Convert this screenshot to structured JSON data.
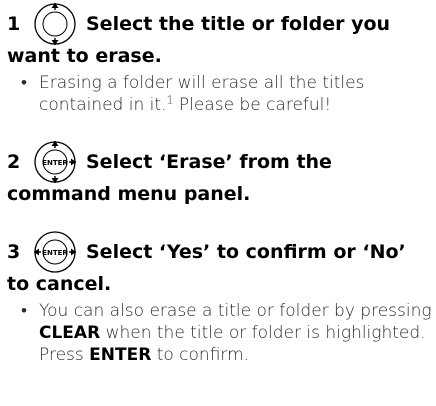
{
  "steps": [
    {
      "number": "1",
      "icon": "dpad-up-down-icon",
      "title_part1": "Select the title or folder you",
      "title_part2": "want to erase.",
      "note": {
        "text_before": "Erasing a folder will erase all the titles contained in it.",
        "footnote": "1",
        "text_after": " Please be careful!"
      }
    },
    {
      "number": "2",
      "icon": "enter-dpad-icon",
      "title_part1": "Select ‘Erase’ from the",
      "title_part2": "command menu panel."
    },
    {
      "number": "3",
      "icon": "enter-left-right-icon",
      "title_part1": "Select ‘Yes’ to confirm or ‘No’",
      "title_part2": "to cancel.",
      "note": {
        "text_1": "You can also erase a title or folder by pressing ",
        "bold_1": "CLEAR",
        "text_2": " when the title or folder is highlighted. Press ",
        "bold_2": "ENTER",
        "text_3": " to confirm."
      }
    }
  ],
  "icon_labels": {
    "enter": "ENTER"
  },
  "colors": {
    "text": "#000000",
    "body_text": "#2a2a2a",
    "icon_stroke": "#000000"
  }
}
